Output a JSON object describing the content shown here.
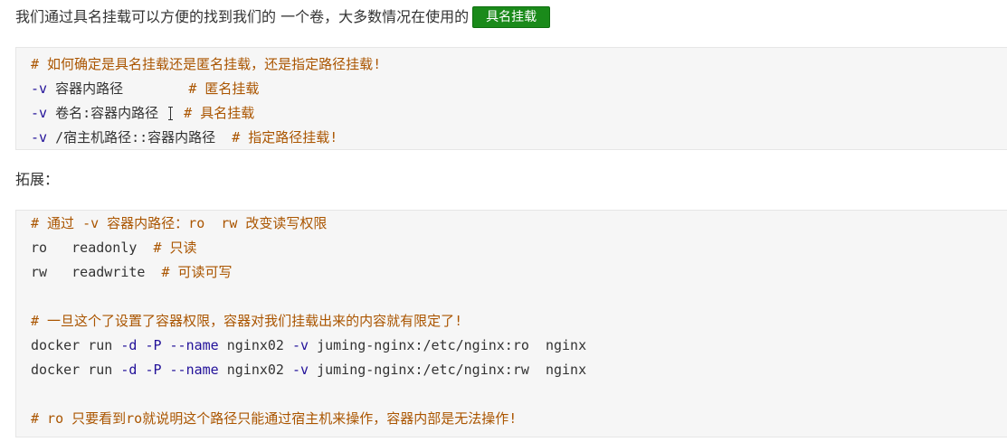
{
  "intro": {
    "text": "我们通过具名挂载可以方便的找到我们的 一个卷，大多数情况在使用的",
    "tag": "具名挂载"
  },
  "code_block_1": {
    "lines": [
      {
        "comment": "# 如何确定是具名挂载还是匿名挂载，还是指定路径挂载!"
      },
      {
        "flag": "-v",
        "text": " 容器内路径        ",
        "comment": "# 匿名挂载"
      },
      {
        "flag": "-v",
        "text": " 卷名:容器内路径 ",
        "comment": " # 具名挂载"
      },
      {
        "flag": "-v",
        "text": " /宿主机路径::容器内路径  ",
        "comment": "# 指定路径挂载!"
      }
    ]
  },
  "extension_label": "拓展：",
  "code_block_2": {
    "line1": "# 通过 -v 容器内路径：ro  rw 改变读写权限",
    "line2": {
      "text": "ro   readonly  ",
      "comment": "# 只读"
    },
    "line3": {
      "text": "rw   readwrite  ",
      "comment": "# 可读可写"
    },
    "line5": "# 一旦这个了设置了容器权限，容器对我们挂载出来的内容就有限定了!",
    "cmd1": {
      "a": "docker run ",
      "f1": "-d",
      "b": " ",
      "f2": "-P",
      "c": " ",
      "f3": "--name",
      "d": " nginx02 ",
      "f4": "-v",
      "e": " juming-nginx:/etc/nginx:ro  nginx"
    },
    "cmd2": {
      "a": "docker run ",
      "f1": "-d",
      "b": " ",
      "f2": "-P",
      "c": " ",
      "f3": "--name",
      "d": " nginx02 ",
      "f4": "-v",
      "e": " juming-nginx:/etc/nginx:rw  nginx"
    },
    "line9": "# ro 只要看到ro就说明这个路径只能通过宿主机来操作，容器内部是无法操作!"
  },
  "colors": {
    "comment": "#aa5500",
    "keyword": "#221199",
    "tag_bg": "#1a8a1a",
    "code_bg": "#f6f6f6"
  }
}
